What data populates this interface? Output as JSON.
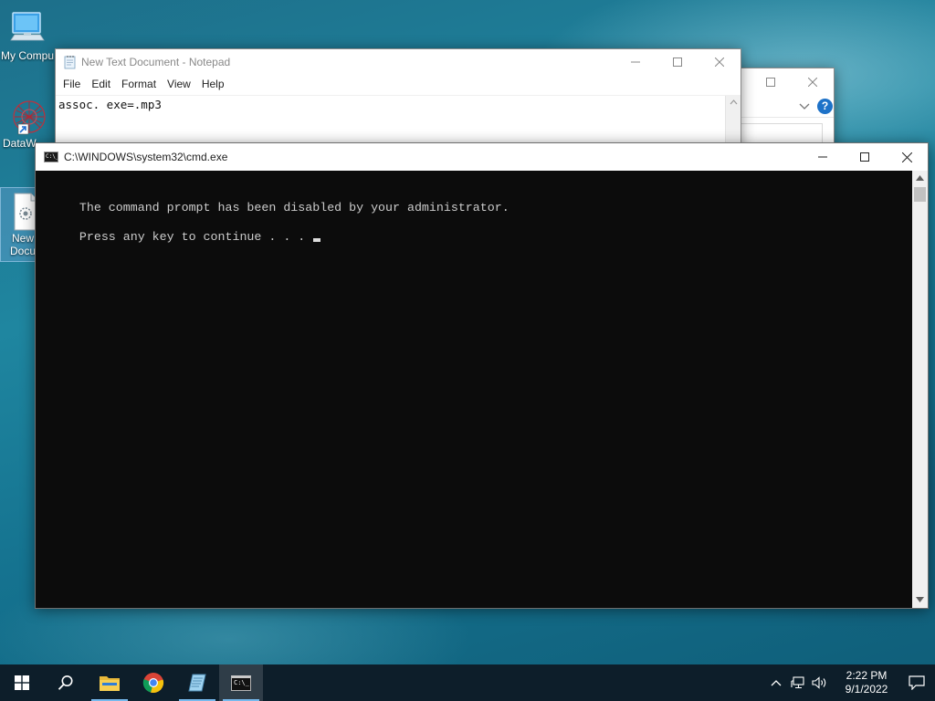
{
  "desktop": {
    "icons": [
      {
        "label": "My Compu"
      },
      {
        "label": "DataW"
      },
      {
        "label_line1": "New",
        "label_line2": "Docu"
      }
    ]
  },
  "back_window": {
    "help_glyph": "?"
  },
  "notepad": {
    "title": "New Text Document - Notepad",
    "menu": [
      "File",
      "Edit",
      "Format",
      "View",
      "Help"
    ],
    "content": "assoc. exe=.mp3"
  },
  "cmd": {
    "title": "C:\\WINDOWS\\system32\\cmd.exe",
    "icon_text": "C:\\_",
    "lines": [
      "The command prompt has been disabled by your administrator.",
      "Press any key to continue . . . "
    ]
  },
  "taskbar": {
    "apps": [
      "start-icon",
      "search-icon",
      "file-explorer-icon",
      "chrome-icon",
      "notepad-icon",
      "cmd-icon"
    ],
    "cmd_icon_text": "C:\\_",
    "clock": {
      "time": "2:22 PM",
      "date": "9/1/2022"
    }
  },
  "colors": {
    "cmd_background": "#0c0c0c",
    "cmd_text": "#cccccc",
    "taskbar": "#0d1e2a",
    "accent": "#0078d7"
  }
}
